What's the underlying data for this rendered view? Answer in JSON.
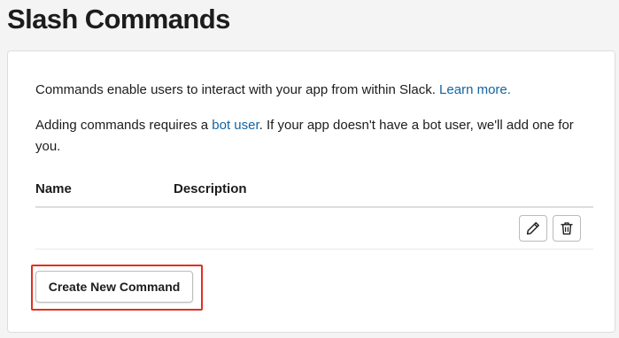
{
  "page": {
    "title": "Slash Commands"
  },
  "intro": {
    "line1_text": "Commands enable users to interact with your app from within Slack. ",
    "line1_link": "Learn more.",
    "line2_before": "Adding commands requires a ",
    "line2_link": "bot user",
    "line2_after": ". If your app doesn't have a bot user, we'll add one for you."
  },
  "table": {
    "columns": [
      "Name",
      "Description"
    ],
    "rows": [
      {
        "name": "",
        "description": "",
        "actions": [
          "pencil-icon",
          "trash-icon"
        ]
      }
    ]
  },
  "actions": {
    "create_label": "Create New Command"
  },
  "colors": {
    "link": "#1264a3",
    "highlight": "#e0301e",
    "text": "#1d1c1d"
  }
}
